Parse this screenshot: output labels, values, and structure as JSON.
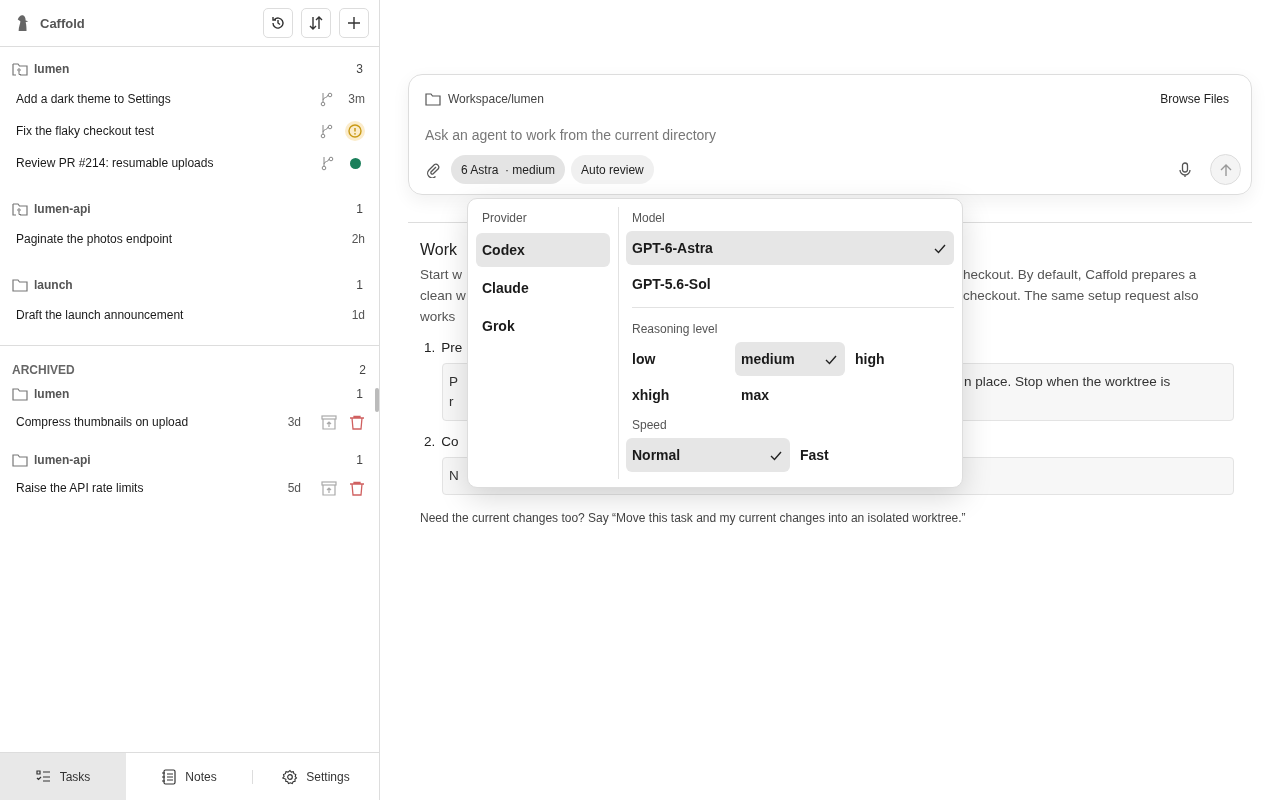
{
  "app": {
    "title": "Caffold"
  },
  "groups": [
    {
      "name": "lumen",
      "count": "3",
      "kind": "repo",
      "tasks": [
        {
          "title": "Add a dark theme to Settings",
          "branch": true,
          "kind": "time",
          "time": "3m"
        },
        {
          "title": "Fix the flaky checkout test",
          "branch": true,
          "kind": "warning"
        },
        {
          "title": "Review PR #214: resumable uploads",
          "branch": true,
          "kind": "dot",
          "color": "#1a7f5a"
        }
      ]
    },
    {
      "name": "lumen-api",
      "count": "1",
      "kind": "repo",
      "tasks": [
        {
          "title": "Paginate the photos endpoint",
          "branch": false,
          "kind": "time",
          "time": "2h"
        }
      ]
    },
    {
      "name": "launch",
      "count": "1",
      "kind": "folder",
      "tasks": [
        {
          "title": "Draft the launch announcement",
          "branch": false,
          "kind": "time",
          "time": "1d"
        }
      ]
    }
  ],
  "archived": {
    "label": "ARCHIVED",
    "count": "2",
    "groups": [
      {
        "name": "lumen",
        "count": "1",
        "tasks": [
          {
            "title": "Compress thumbnails on upload",
            "time": "3d"
          }
        ]
      },
      {
        "name": "lumen-api",
        "count": "1",
        "tasks": [
          {
            "title": "Raise the API rate limits",
            "time": "5d"
          }
        ]
      }
    ]
  },
  "bottom_tabs": [
    {
      "label": "Tasks",
      "selected": true
    },
    {
      "label": "Notes",
      "selected": false
    },
    {
      "label": "Settings",
      "selected": false
    }
  ],
  "composer": {
    "path": "Workspace/lumen",
    "browse": "Browse Files",
    "placeholder": "Ask an agent to work from the current directory",
    "chips": [
      "6 Astra  · medium",
      "Auto review"
    ]
  },
  "doc": {
    "lines": [
      {
        "kind": "heading",
        "left": "Work"
      },
      {
        "kind": "para",
        "left": "Start w",
        "right": "heckout. By default, Caffold prepares a"
      },
      {
        "kind": "para",
        "left": "clean w",
        "right": "checkout. The same setup request also"
      },
      {
        "kind": "para",
        "left": "works"
      },
      {
        "kind": "step",
        "num": "1.",
        "left": "Pre"
      },
      {
        "kind": "code",
        "lines": [
          {
            "left": "P",
            "right": "n place. Stop when the worktree is"
          },
          {
            "left": "r"
          }
        ]
      },
      {
        "kind": "step",
        "num": "2.",
        "left": "Co"
      },
      {
        "kind": "code",
        "lines": [
          {
            "left": "N"
          }
        ]
      }
    ],
    "footer": "Need the current changes too? Say “Move this task and my current changes into an isolated worktree.”"
  },
  "picker": {
    "provider_label": "Provider",
    "providers": [
      {
        "label": "Codex",
        "selected": true
      },
      {
        "label": "Claude",
        "selected": false
      },
      {
        "label": "Grok",
        "selected": false
      }
    ],
    "model_label": "Model",
    "models": [
      {
        "label": "GPT-6-Astra",
        "selected": true
      },
      {
        "label": "GPT-5.6-Sol",
        "selected": false
      }
    ],
    "reasoning_label": "Reasoning level",
    "reasoning": [
      {
        "label": "low",
        "selected": false
      },
      {
        "label": "medium",
        "selected": true
      },
      {
        "label": "high",
        "selected": false
      },
      {
        "label": "xhigh",
        "selected": false
      },
      {
        "label": "max",
        "selected": false
      }
    ],
    "speed_label": "Speed",
    "speeds": [
      {
        "label": "Normal",
        "selected": true
      },
      {
        "label": "Fast",
        "selected": false
      }
    ]
  }
}
